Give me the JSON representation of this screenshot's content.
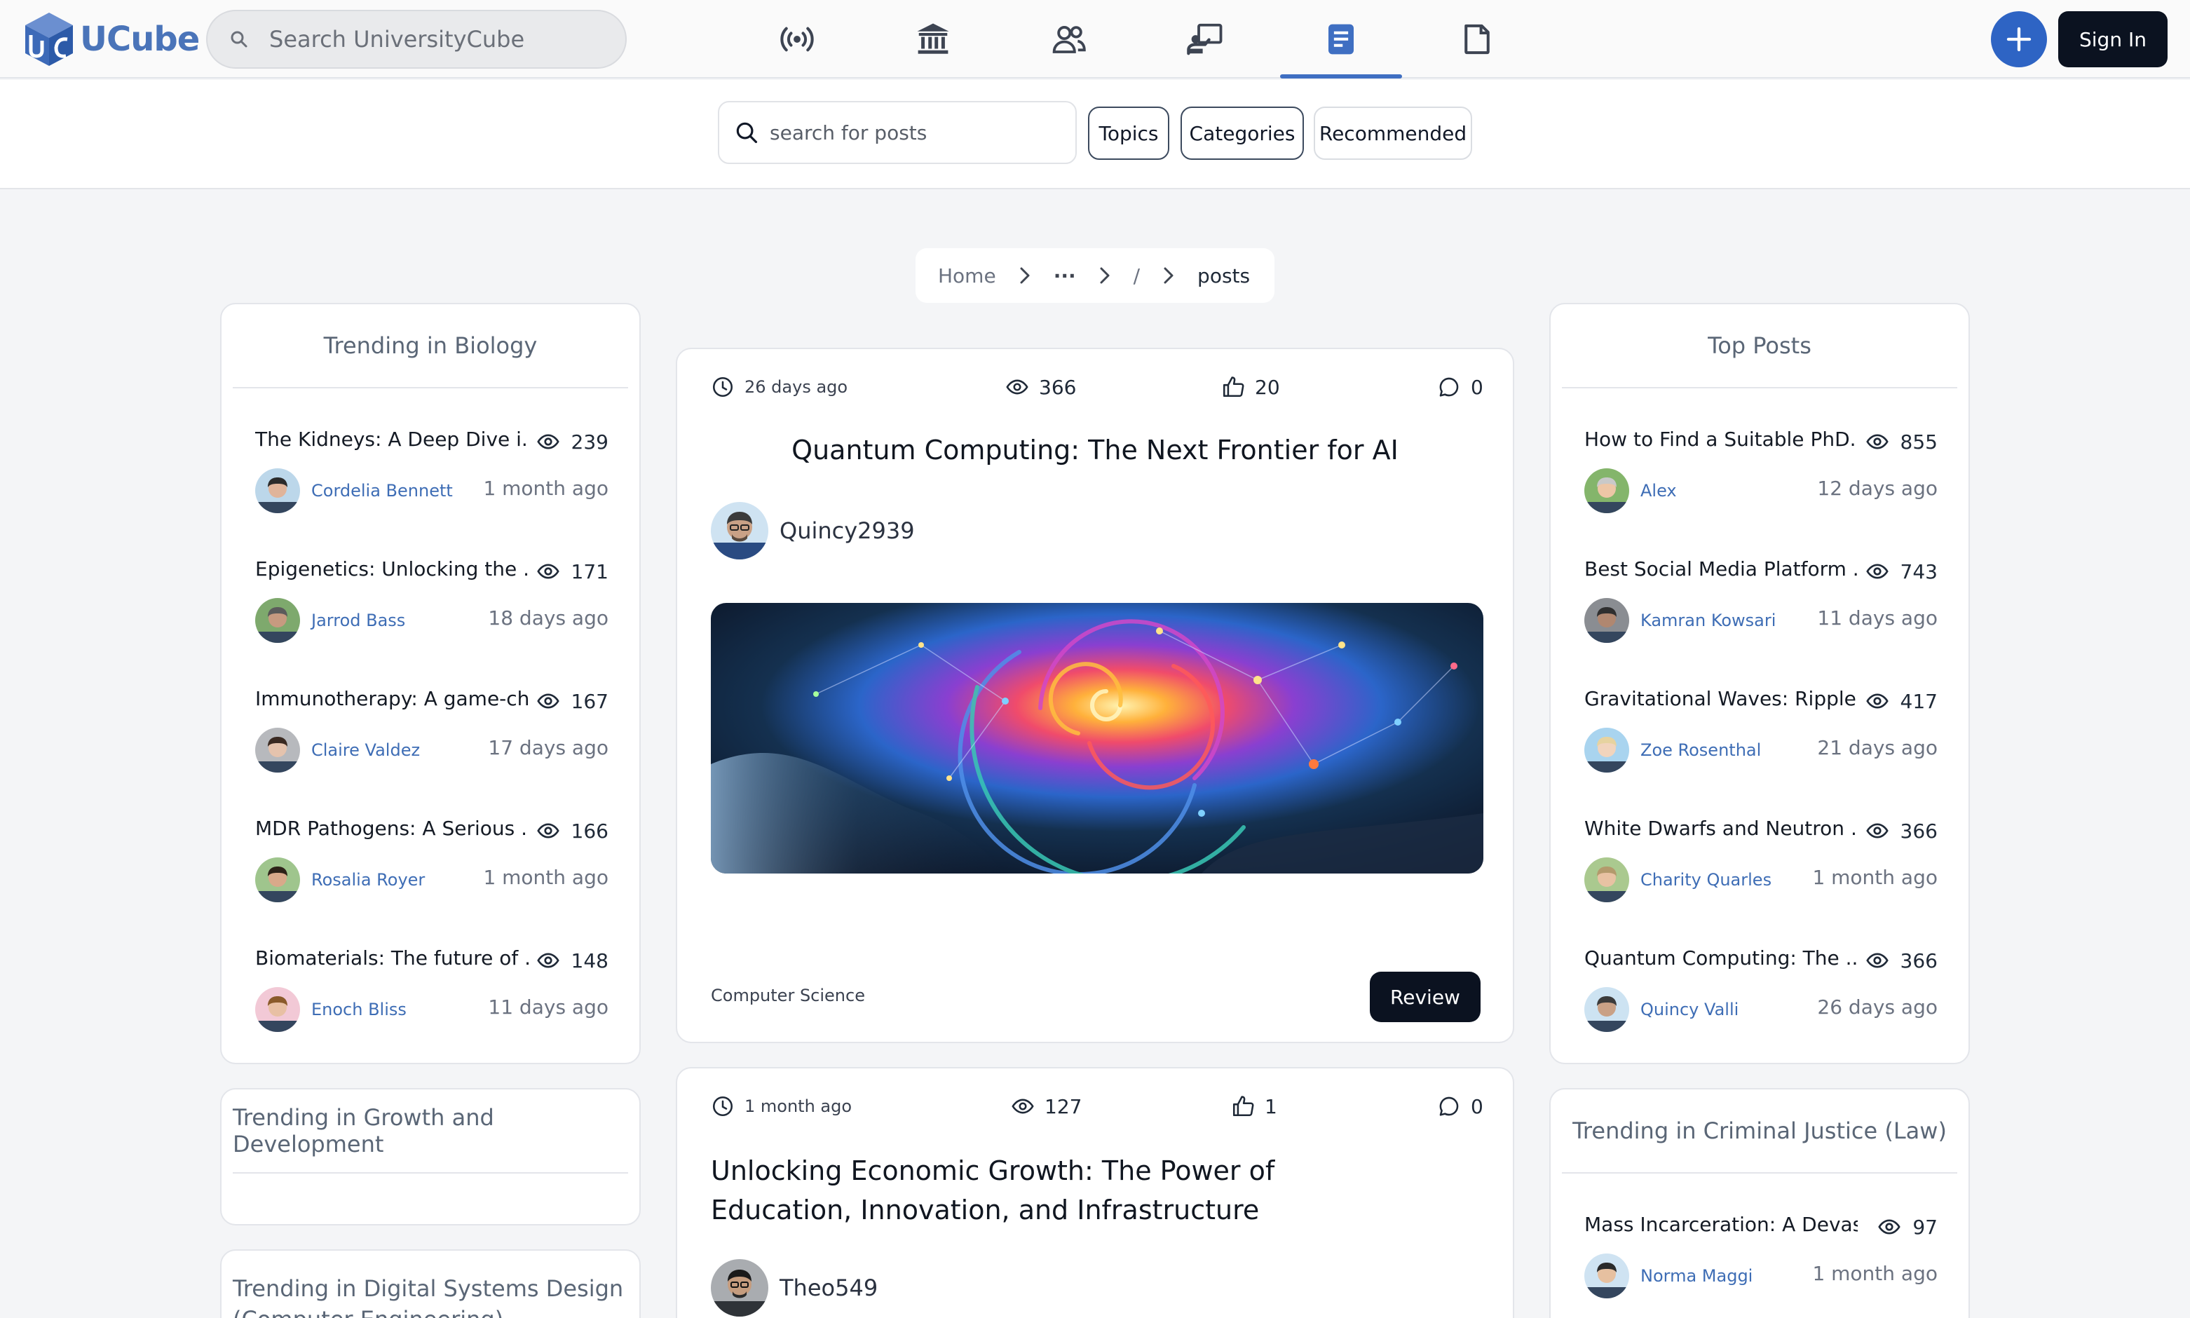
{
  "app": {
    "logo_text": "UCube",
    "global_search_placeholder": "Search UniversityCube",
    "nav_icons": [
      "broadcast-icon",
      "institution-icon",
      "people-icon",
      "classroom-icon",
      "posts-icon",
      "document-icon"
    ],
    "active_nav": "posts-icon",
    "signin_label": "Sign In"
  },
  "filters": {
    "search_placeholder": "search for posts",
    "chips": [
      "Topics",
      "Categories",
      "Recommended"
    ]
  },
  "breadcrumb": {
    "home": "Home",
    "ellipsis": "···",
    "slash": "/",
    "current": "posts"
  },
  "left_cards": [
    {
      "title": "Trending in Biology",
      "items": [
        {
          "title": "The Kidneys: A Deep Dive i...",
          "views": "239",
          "author": "Cordelia Bennett",
          "time": "1 month ago"
        },
        {
          "title": "Epigenetics: Unlocking the ...",
          "views": "171",
          "author": "Jarrod Bass",
          "time": "18 days ago"
        },
        {
          "title": "Immunotherapy: A game-ch...",
          "views": "167",
          "author": "Claire Valdez",
          "time": "17 days ago"
        },
        {
          "title": "MDR Pathogens: A Serious ...",
          "views": "166",
          "author": "Rosalia Royer",
          "time": "1 month ago"
        },
        {
          "title": "Biomaterials: The future of ...",
          "views": "148",
          "author": "Enoch Bliss",
          "time": "11 days ago"
        }
      ]
    },
    {
      "title": "Trending in Growth and Development"
    },
    {
      "title": "Trending in Digital Systems Design (Computer Engineering)"
    }
  ],
  "right_cards": [
    {
      "title": "Top Posts",
      "items": [
        {
          "title": "How to Find a Suitable PhD...",
          "views": "855",
          "author": "Alex",
          "time": "12 days ago"
        },
        {
          "title": "Best Social Media Platform ...",
          "views": "743",
          "author": "Kamran Kowsari",
          "time": "11 days ago"
        },
        {
          "title": "Gravitational Waves: Ripple...",
          "views": "417",
          "author": "Zoe Rosenthal",
          "time": "21 days ago"
        },
        {
          "title": "White Dwarfs and Neutron ...",
          "views": "366",
          "author": "Charity Quarles",
          "time": "1 month ago"
        },
        {
          "title": "Quantum Computing: The ...",
          "views": "366",
          "author": "Quincy Valli",
          "time": "26 days ago"
        }
      ]
    },
    {
      "title": "Trending in Criminal Justice (Law)",
      "items": [
        {
          "title": "Mass Incarceration: A Devast...",
          "views": "97",
          "author": "Norma Maggi",
          "time": "1 month ago"
        }
      ]
    }
  ],
  "posts": [
    {
      "time": "26 days ago",
      "views": "366",
      "likes": "20",
      "comments": "0",
      "title": "Quantum Computing: The Next Frontier for AI",
      "author": "Quincy2939",
      "category": "Computer Science",
      "review_label": "Review"
    },
    {
      "time": "1 month ago",
      "views": "127",
      "likes": "1",
      "comments": "0",
      "title": "Unlocking Economic Growth: The Power of Education, Innovation, and Infrastructure",
      "author": "Theo549"
    }
  ],
  "colors": {
    "brand": "#4a74b9",
    "accent": "#2e64c4",
    "dark_button": "#0b1220",
    "author_link": "#3e6db5",
    "page_bg": "#f4f5f7"
  }
}
